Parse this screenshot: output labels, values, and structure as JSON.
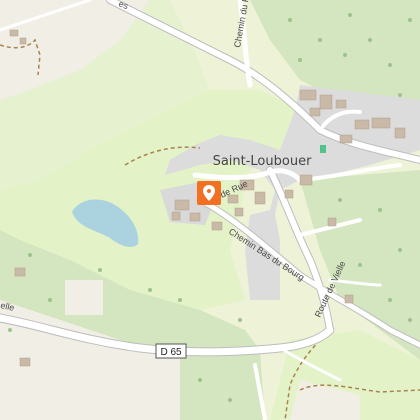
{
  "map": {
    "place_name": "Saint-Loubouer",
    "streets": {
      "route_de_vielle": "Route de Vielle",
      "chemin_bas_du_bourg": "Chemin Bas du Bourg",
      "chemin_du_p": "Chemin du P",
      "de_rue": "de Rue",
      "partial_top_left": "es",
      "partial_left": "elle"
    },
    "road_shield": "D 65",
    "marker_icon": "map-pin-icon",
    "colors": {
      "background": "#eef3d8",
      "farmland": "#f1eee6",
      "forest": "#d3e6bf",
      "meadow": "#e3f2c7",
      "residential": "#dcdcdc",
      "water": "#aad3df",
      "building": "#c9b9a7",
      "road": "#ffffff",
      "marker": "#f36f21",
      "track": "#a98350"
    }
  }
}
